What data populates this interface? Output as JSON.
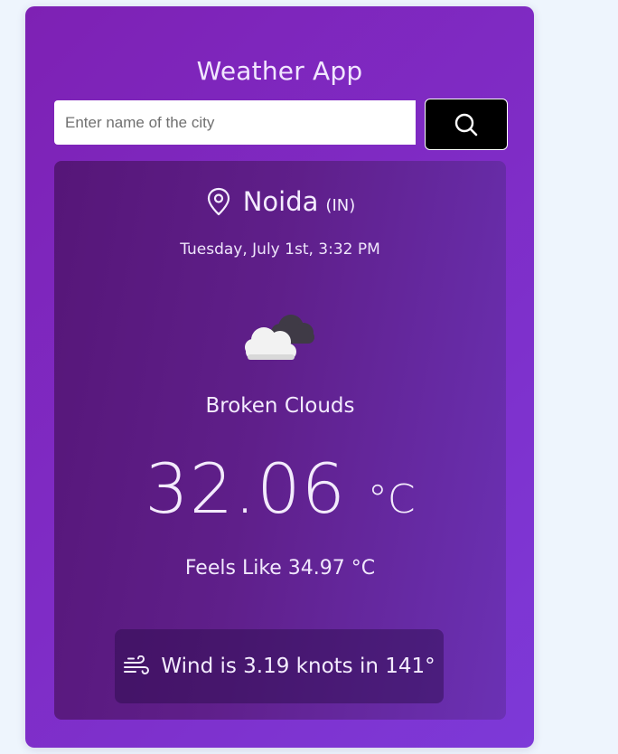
{
  "app": {
    "title": "Weather App"
  },
  "search": {
    "placeholder": "Enter name of the city",
    "value": "",
    "button_icon": "search-icon"
  },
  "weather": {
    "city": "Noida",
    "country": "(IN)",
    "datetime": "Tuesday, July 1st, 3:32 PM",
    "icon": "broken-clouds-icon",
    "description": "Broken Clouds",
    "temperature": "32.06",
    "unit": "°C",
    "feels_like": "Feels Like 34.97 °C",
    "wind_icon": "wind-icon",
    "wind": "Wind is 3.19 knots in 141°"
  },
  "colors": {
    "page_background": "#eef5fd",
    "card_gradient_start": "#7e21b4",
    "card_gradient_end": "#7d39d8",
    "panel_gradient_start": "#561678",
    "panel_gradient_end": "#6b31b4",
    "search_button": "#000000"
  }
}
